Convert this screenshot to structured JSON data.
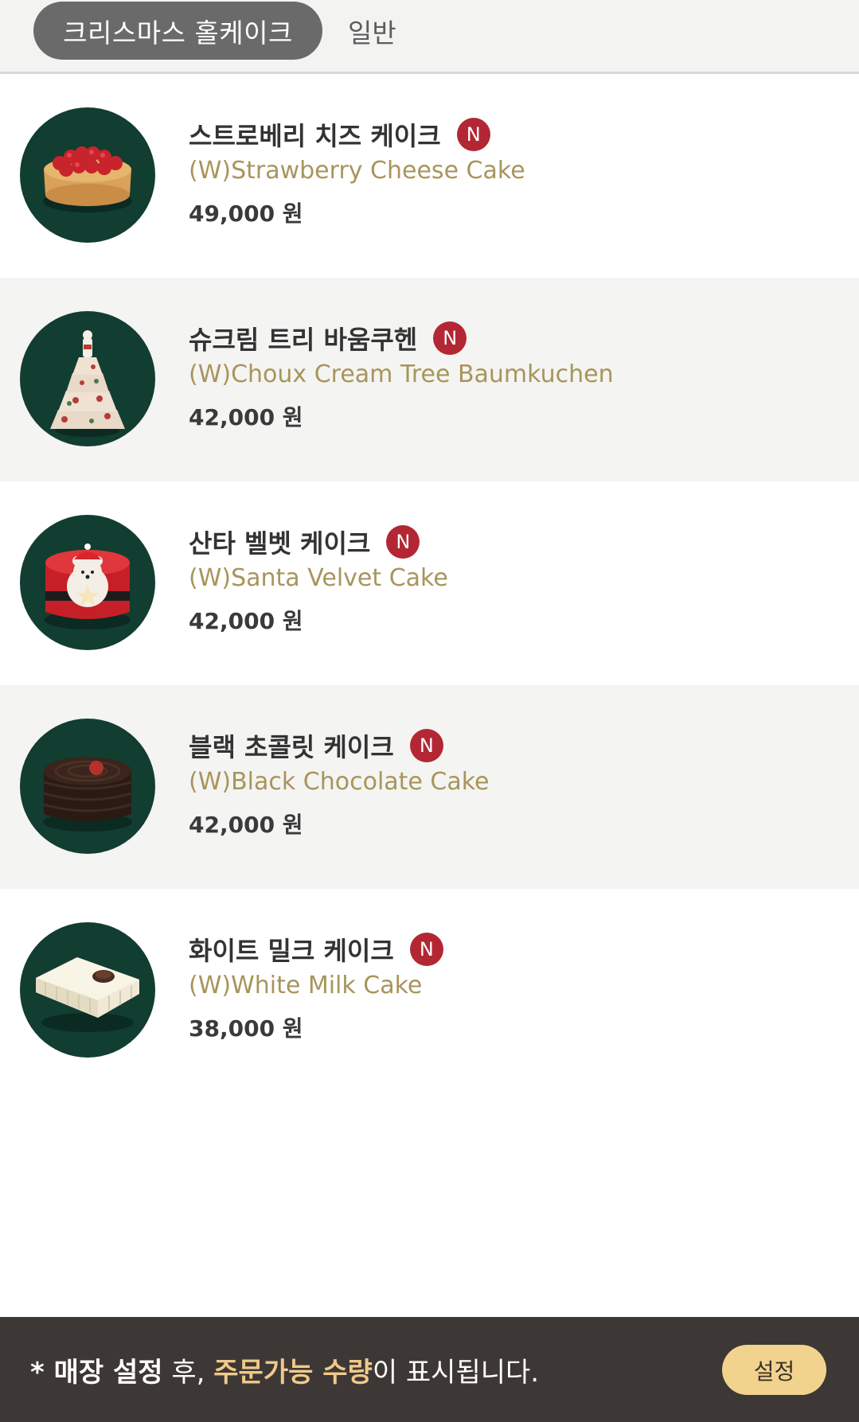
{
  "tabs": {
    "active_label": "크리스마스 홀케이크",
    "other_label": "일반"
  },
  "badge_label": "N",
  "products": [
    {
      "name": "스트로베리 치즈 케이크",
      "english_name": "(W)Strawberry Cheese Cake",
      "price": "49,000 원",
      "image": "strawberry-cheese-cake-image"
    },
    {
      "name": "슈크림 트리 바움쿠헨",
      "english_name": "(W)Choux Cream Tree Baumkuchen",
      "price": "42,000 원",
      "image": "tree-baumkuchen-image"
    },
    {
      "name": "산타 벨벳 케이크",
      "english_name": "(W)Santa Velvet Cake",
      "price": "42,000 원",
      "image": "santa-velvet-cake-image"
    },
    {
      "name": "블랙 초콜릿 케이크",
      "english_name": "(W)Black Chocolate Cake",
      "price": "42,000 원",
      "image": "black-chocolate-cake-image"
    },
    {
      "name": "화이트 밀크 케이크",
      "english_name": "(W)White Milk Cake",
      "price": "38,000 원",
      "image": "white-milk-cake-image"
    }
  ],
  "footer": {
    "notice_prefix": "* 매장 설정",
    "notice_mid": " 후, ",
    "notice_highlight": "주문가능 수량",
    "notice_suffix": "이 표시됩니다.",
    "button_label": "설정"
  },
  "colors": {
    "thumb_bg": "#123d31",
    "badge": "#b22733",
    "english_name": "#a8955c",
    "footer_bg": "#3d3835",
    "highlight": "#f0c98a",
    "button_bg": "#f2d38e"
  }
}
